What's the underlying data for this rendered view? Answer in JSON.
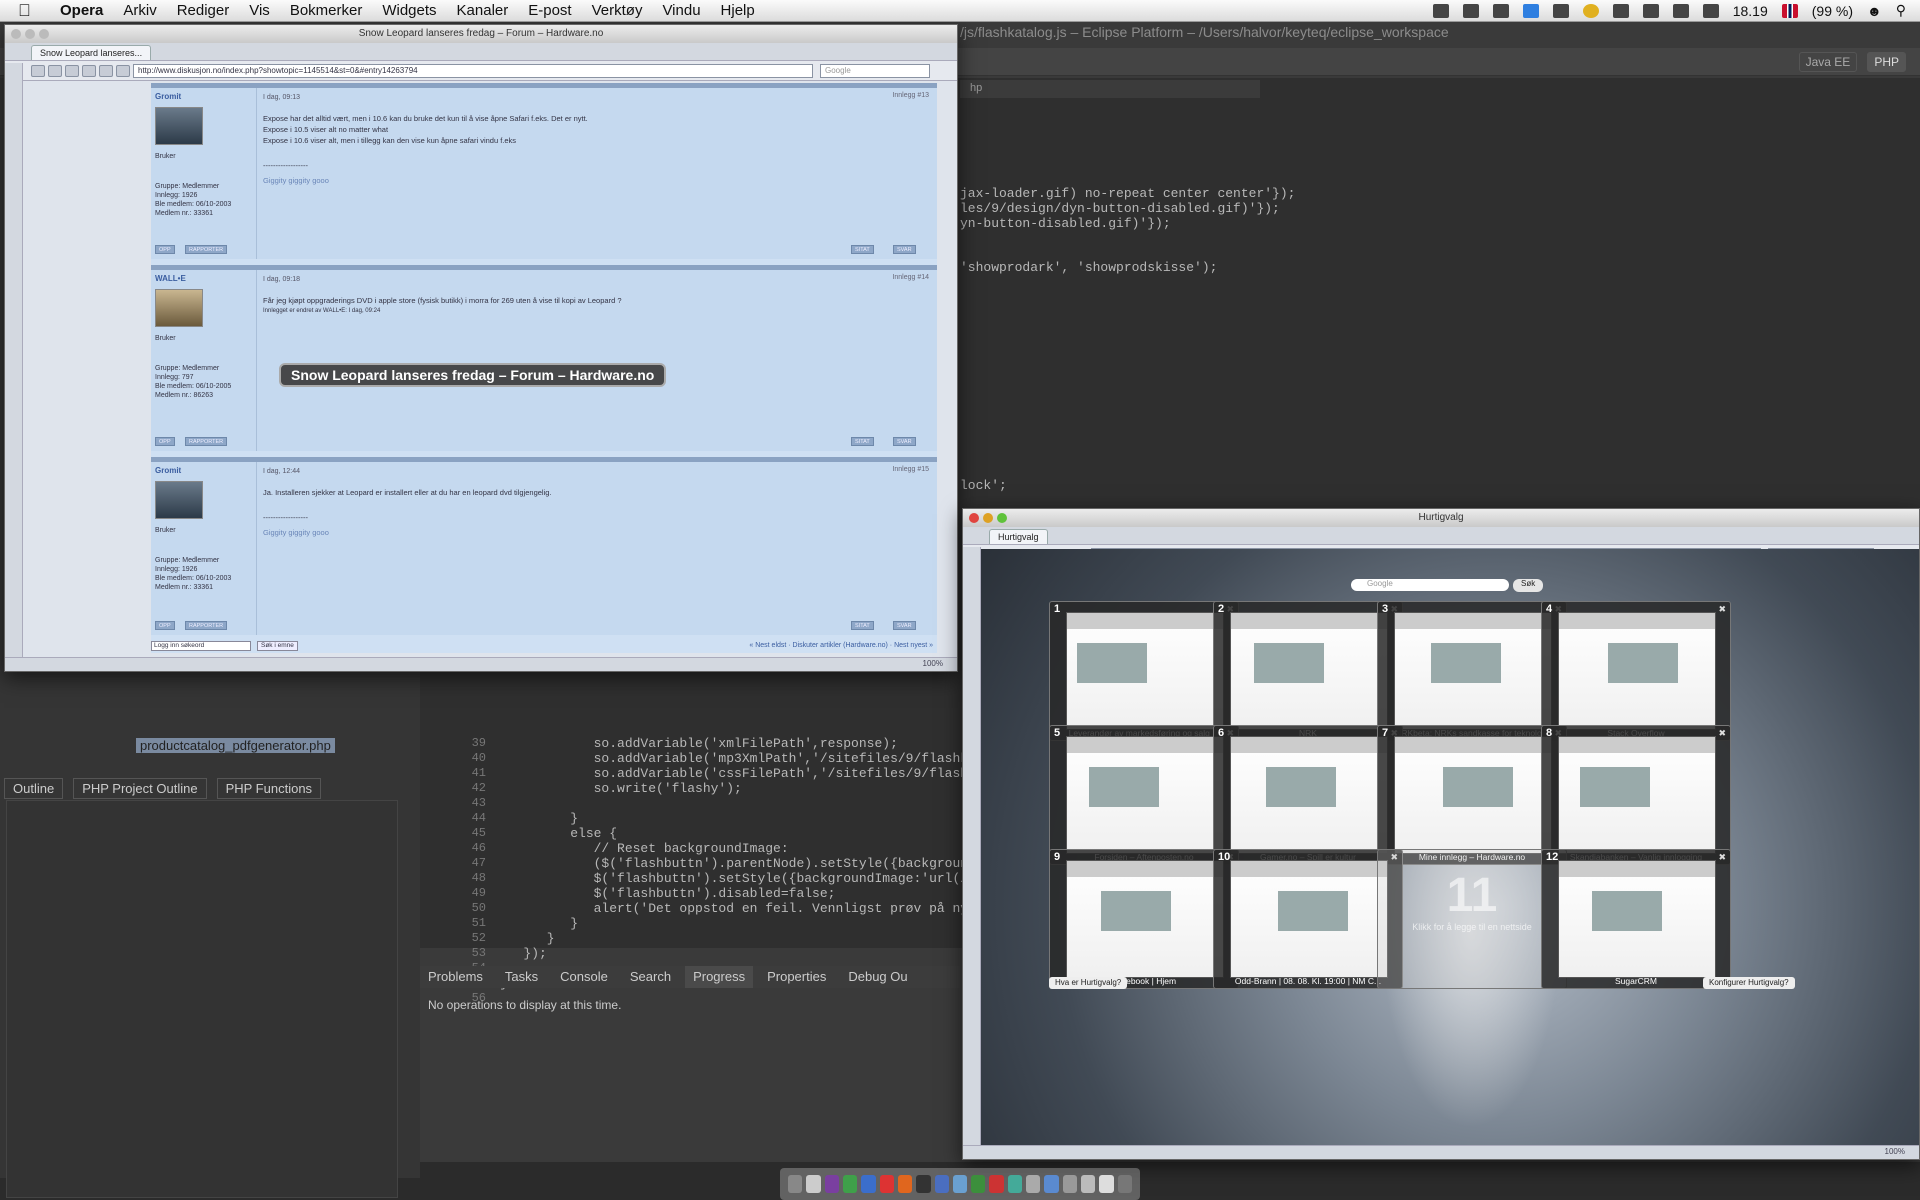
{
  "menubar": {
    "apple": "",
    "app": "Opera",
    "items": [
      "Arkiv",
      "Rediger",
      "Vis",
      "Bokmerker",
      "Widgets",
      "Kanaler",
      "E-post",
      "Verktøy",
      "Vindu",
      "Hjelp"
    ],
    "clock": "18.19",
    "battery": "(99 %)"
  },
  "eclipse": {
    "title": "/js/flashkatalog.js – Eclipse Platform – /Users/halvor/keyteq/eclipse_workspace",
    "perspectives": [
      "Java EE",
      "PHP"
    ],
    "editor_tab": "hp",
    "code_top": [
      "jax-loader.gif) no-repeat center center'});",
      "les/9/design/dyn-button-disabled.gif)'});",
      "yn-button-disabled.gif)'});",
      "'showprodark', 'showprodskisse');",
      "lock';"
    ],
    "code_bottom": [
      {
        "n": "39",
        "t": "            so.addVariable('xmlFilePath',response);"
      },
      {
        "n": "40",
        "t": "            so.addVariable('mp3XmlPath','/sitefiles/9/flashkatalog/x"
      },
      {
        "n": "41",
        "t": "            so.addVariable('cssFilePath','/sitefiles/9/flashkatalog/"
      },
      {
        "n": "42",
        "t": "            so.write('flashy');"
      },
      {
        "n": "43",
        "t": ""
      },
      {
        "n": "44",
        "t": "         }"
      },
      {
        "n": "45",
        "t": "         else {"
      },
      {
        "n": "46",
        "t": "            // Reset backgroundImage:"
      },
      {
        "n": "47",
        "t": "            ($('flashbuttn').parentNode).setStyle({backgroundImage:'"
      },
      {
        "n": "48",
        "t": "            $('flashbuttn').setStyle({backgroundImage:'url(/sitefile"
      },
      {
        "n": "49",
        "t": "            $('flashbuttn').disabled=false;"
      },
      {
        "n": "50",
        "t": "            alert('Det oppstod en feil. Vennligst prøv på ny');"
      },
      {
        "n": "51",
        "t": "         }"
      },
      {
        "n": "52",
        "t": "      }"
      },
      {
        "n": "53",
        "t": "   });"
      },
      {
        "n": "54",
        "t": ""
      },
      {
        "n": "55",
        "t": "}"
      },
      {
        "n": "56",
        "t": ""
      }
    ],
    "file_row": "productcatalog_pdfgenerator.php",
    "outline_tabs": [
      "Outline",
      "PHP Project Outline",
      "PHP Functions"
    ],
    "bottom_tabs": [
      "Problems",
      "Tasks",
      "Console",
      "Search",
      "Progress",
      "Properties",
      "Debug Ou"
    ],
    "bottom_message": "No operations to display at this time."
  },
  "forum_window": {
    "title": "Snow Leopard lanseres fredag – Forum – Hardware.no",
    "tab": "Snow Leopard lanseres...",
    "url": "http://www.diskusjon.no/index.php?showtopic=1145514&st=0&#entry14263794",
    "search_placeholder": "Google",
    "tooltip": "Snow Leopard lanseres fredag – Forum – Hardware.no",
    "posts": [
      {
        "user": "Gromit",
        "date": "I dag, 09:13",
        "num": "Innlegg #13",
        "lines": [
          "Expose har det alltid vært, men i 10.6 kan du bruke det kun til å vise åpne Safari f.eks. Det er nytt.",
          "",
          "Expose i 10.5 viser alt no matter what",
          "Expose i 10.6 viser alt, men i tillegg kan den vise kun åpne safari vindu f.eks"
        ],
        "sig": "Giggity giggity gooo",
        "role": "Bruker",
        "meta": [
          "Gruppe: Medlemmer",
          "Innlegg: 1926",
          "Ble medlem: 06/10-2003",
          "Medlem nr.: 33361"
        ]
      },
      {
        "user": "WALL•E",
        "date": "I dag, 09:18",
        "num": "Innlegg #14",
        "lines": [
          "Får jeg kjøpt oppgraderings DVD i apple store (fysisk butikk) i morra for 269 uten å vise til kopi av Leopard ?",
          "",
          "Innlegget er endret av WALL•E: I dag, 09:24"
        ],
        "sig": "",
        "role": "Bruker",
        "meta": [
          "Gruppe: Medlemmer",
          "Innlegg: 797",
          "Ble medlem: 06/10-2005",
          "Medlem nr.: 86263"
        ]
      },
      {
        "user": "Gromit",
        "date": "I dag, 12:44",
        "num": "Innlegg #15",
        "lines": [
          "Ja. Installeren sjekker at Leopard er installert eller at du har en leopard dvd tilgjengelig."
        ],
        "sig": "Giggity giggity gooo",
        "role": "Bruker",
        "meta": [
          "Gruppe: Medlemmer",
          "Innlegg: 1926",
          "Ble medlem: 06/10-2003",
          "Medlem nr.: 33361"
        ]
      }
    ],
    "post_buttons": [
      "OPP",
      "RAPPORTER",
      "SITAT",
      "SVAR"
    ],
    "footer_left": "Logg inn søkeord",
    "footer_search": "Søk i emne",
    "footer_right": "« Nest eldst · Diskuter artikler (Hardware.no) · Nest nyest »",
    "zoom": "100%"
  },
  "speeddial_window": {
    "title": "Hurtigvalg",
    "tab": "Hurtigvalg",
    "search_placeholder": "Google",
    "search_button": "Søk",
    "tiles": [
      {
        "num": "1",
        "caption": "Leverandør av markedsføring og salg ..."
      },
      {
        "num": "2",
        "caption": "NRK"
      },
      {
        "num": "3",
        "caption": "NRKbeta: NRKs sandkasse for teknolo..."
      },
      {
        "num": "4",
        "caption": "Stack Overflow"
      },
      {
        "num": "5",
        "caption": "Forsiden – Aftenposten.no"
      },
      {
        "num": "6",
        "caption": "Gamer.no – Spill er kultur"
      },
      {
        "num": "7",
        "caption": "Mine innlegg – Hardware.no"
      },
      {
        "num": "8",
        "caption": "Skandiabanken – Vanlig innlogging"
      },
      {
        "num": "9",
        "caption": "Facebook | Hjem"
      },
      {
        "num": "10",
        "caption": "Odd-Brann | 08. 08. Kl. 19:00 | NM C..."
      },
      {
        "num": "11",
        "caption": "Klikk for å legge til en nettside"
      },
      {
        "num": "12",
        "caption": "SugarCRM"
      }
    ],
    "help_link": "Hva er Hurtigvalg?",
    "configure_link": "Konfigurer Hurtigvalg?",
    "zoom": "100%"
  }
}
